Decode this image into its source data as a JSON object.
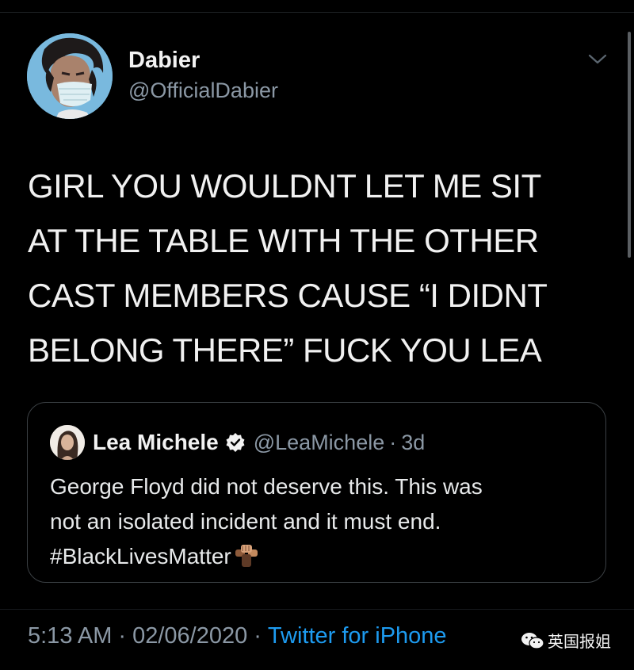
{
  "tweet": {
    "author_name": "Dabier",
    "author_handle": "@OfficialDabier",
    "text_lines": [
      "GIRL YOU WOULDNT LET ME SIT",
      "AT THE TABLE WITH THE OTHER",
      "CAST MEMBERS CAUSE “I DIDNT",
      "BELONG THERE” FUCK YOU LEA"
    ],
    "timestamp_time": "5:13 AM",
    "timestamp_separator": "·",
    "timestamp_date": "02/06/2020",
    "source_separator": "·",
    "source": "Twitter for iPhone"
  },
  "quoted_tweet": {
    "author_name": "Lea Michele",
    "author_handle": "@LeaMichele",
    "separator": "·",
    "time_ago": "3d",
    "text_lines": [
      "George Floyd did not deserve this. This was",
      "not an isolated incident and it must end.",
      "#BlackLivesMatter"
    ]
  },
  "watermark": {
    "label": "英国报姐",
    "icon": "wechat-icon"
  },
  "icons": {
    "menu": "chevron-down-icon",
    "verified": "verified-badge-icon",
    "emoji": "raised-fists-emoji"
  },
  "colors": {
    "background": "#000000",
    "text": "#e7e9ea",
    "secondary": "#8b98a5",
    "link": "#1d9bf0",
    "quote_border": "#3b4044"
  }
}
